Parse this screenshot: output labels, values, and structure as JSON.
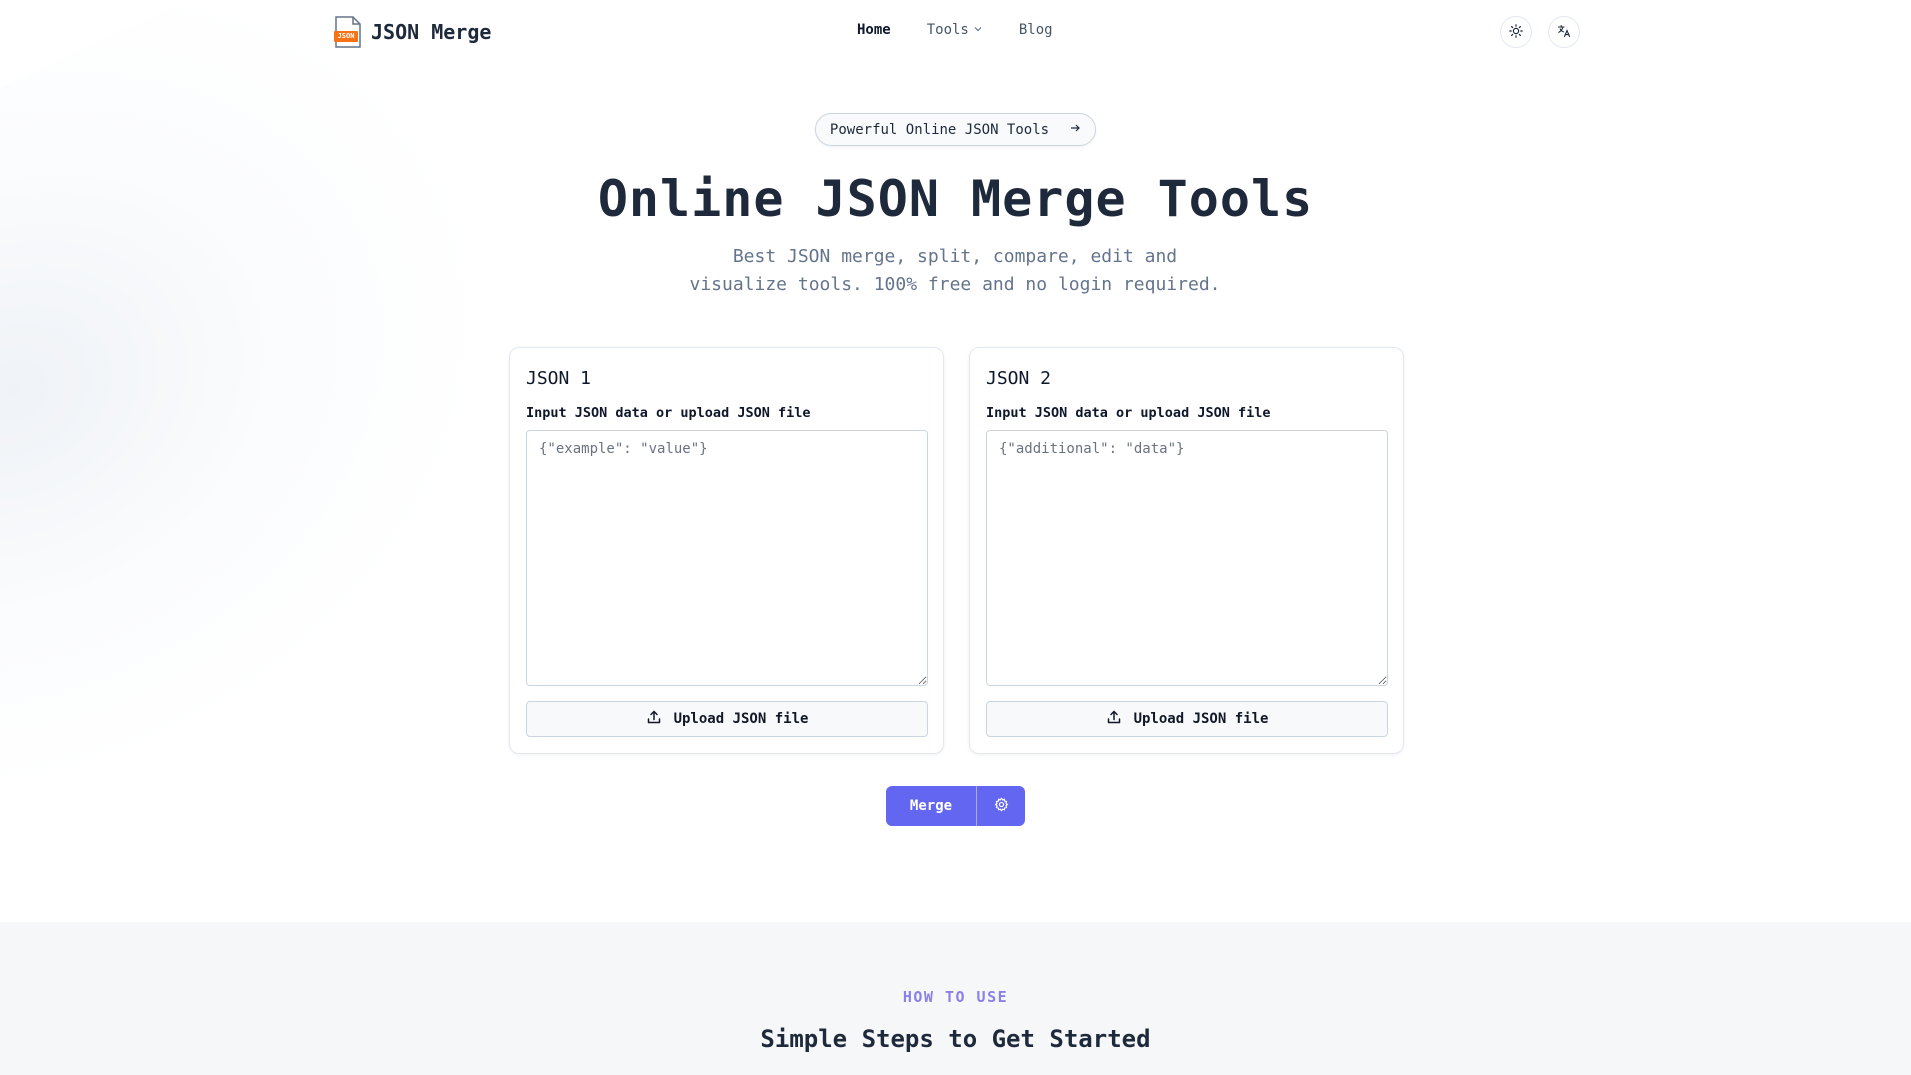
{
  "header": {
    "brand": "JSON Merge",
    "logo_badge": "JSON",
    "nav": [
      {
        "label": "Home",
        "active": true
      },
      {
        "label": "Tools",
        "has_dropdown": true
      },
      {
        "label": "Blog"
      }
    ],
    "icons": [
      "sun-icon",
      "translate-icon"
    ]
  },
  "hero": {
    "pill_label": "Powerful Online JSON Tools",
    "title": "Online JSON Merge Tools",
    "subtitle_line1": "Best JSON merge, split, compare, edit and",
    "subtitle_line2": "visualize tools. 100% free and no login required."
  },
  "editors": [
    {
      "title": "JSON 1",
      "label": "Input JSON data or upload JSON file",
      "value": "",
      "placeholder": "{\"example\": \"value\"}",
      "upload_label": "Upload JSON file"
    },
    {
      "title": "JSON 2",
      "label": "Input JSON data or upload JSON file",
      "value": "",
      "placeholder": "{\"additional\": \"data\"}",
      "upload_label": "Upload JSON file"
    }
  ],
  "actions": {
    "merge_label": "Merge"
  },
  "how_to_use": {
    "eyebrow": "HOW TO USE",
    "title": "Simple Steps to Get Started"
  },
  "colors": {
    "accent": "#6366f1",
    "eyebrow": "#8b7fe8",
    "text": "#1e293b",
    "muted": "#64748b",
    "logo_badge": "#f97316"
  }
}
